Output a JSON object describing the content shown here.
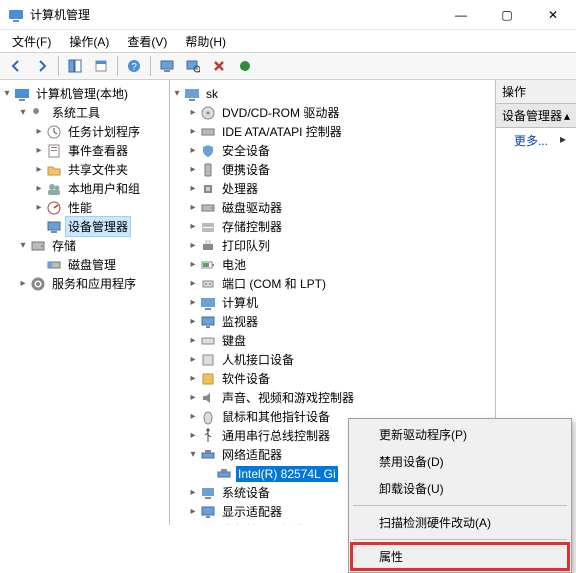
{
  "window": {
    "title": "计算机管理",
    "controls": {
      "min": "—",
      "max": "▢",
      "close": "✕"
    }
  },
  "menu": {
    "file": "文件(F)",
    "action": "操作(A)",
    "view": "查看(V)",
    "help": "帮助(H)"
  },
  "right": {
    "header": "操作",
    "section": "设备管理器",
    "more": "更多..."
  },
  "left_tree": {
    "root": "计算机管理(本地)",
    "sys_tools": "系统工具",
    "task_sched": "任务计划程序",
    "event_viewer": "事件查看器",
    "shared": "共享文件夹",
    "local_users": "本地用户和组",
    "perf": "性能",
    "devmgr": "设备管理器",
    "storage": "存储",
    "diskmgmt": "磁盘管理",
    "svcapps": "服务和应用程序"
  },
  "mid_tree": {
    "root": "sk",
    "dvd": "DVD/CD-ROM 驱动器",
    "ide": "IDE ATA/ATAPI 控制器",
    "security": "安全设备",
    "portable": "便携设备",
    "cpu": "处理器",
    "disk": "磁盘驱动器",
    "storage_ctrl": "存储控制器",
    "print_queue": "打印队列",
    "battery": "电池",
    "ports": "端口 (COM 和 LPT)",
    "computer": "计算机",
    "monitor": "监视器",
    "keyboard": "键盘",
    "hid": "人机接口设备",
    "software": "软件设备",
    "sound": "声音、视频和游戏控制器",
    "mouse": "鼠标和其他指针设备",
    "usb": "通用串行总线控制器",
    "netadapter": "网络适配器",
    "nic0": "Intel(R) 82574L Gi",
    "sysdev": "系统设备",
    "display": "显示适配器",
    "audio_io": "音频输入和输出"
  },
  "context_menu": {
    "update_driver": "更新驱动程序(P)",
    "disable": "禁用设备(D)",
    "uninstall": "卸载设备(U)",
    "scan": "扫描检测硬件改动(A)",
    "properties": "属性"
  }
}
